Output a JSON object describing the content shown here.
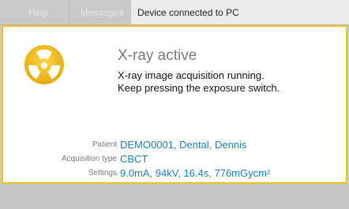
{
  "header": {
    "tabs": [
      {
        "label": "Help"
      },
      {
        "label": "Messages"
      }
    ],
    "status_text": "Device connected to PC"
  },
  "alert": {
    "icon": "radiation-icon",
    "title": "X-ray active",
    "message_line1": "X-ray image acquisition running.",
    "message_line2": "Keep pressing the exposure switch."
  },
  "details": [
    {
      "label": "Patient",
      "value": "DEMO0001, Dental, Dennis"
    },
    {
      "label": "Acquisition type",
      "value": "CBCT"
    },
    {
      "label": "Settings",
      "value": "9.0mA, 94kV, 16.4s, 776mGycm²"
    }
  ],
  "colors": {
    "accent": "#f1c21b",
    "value_text": "#1e7dbf"
  }
}
